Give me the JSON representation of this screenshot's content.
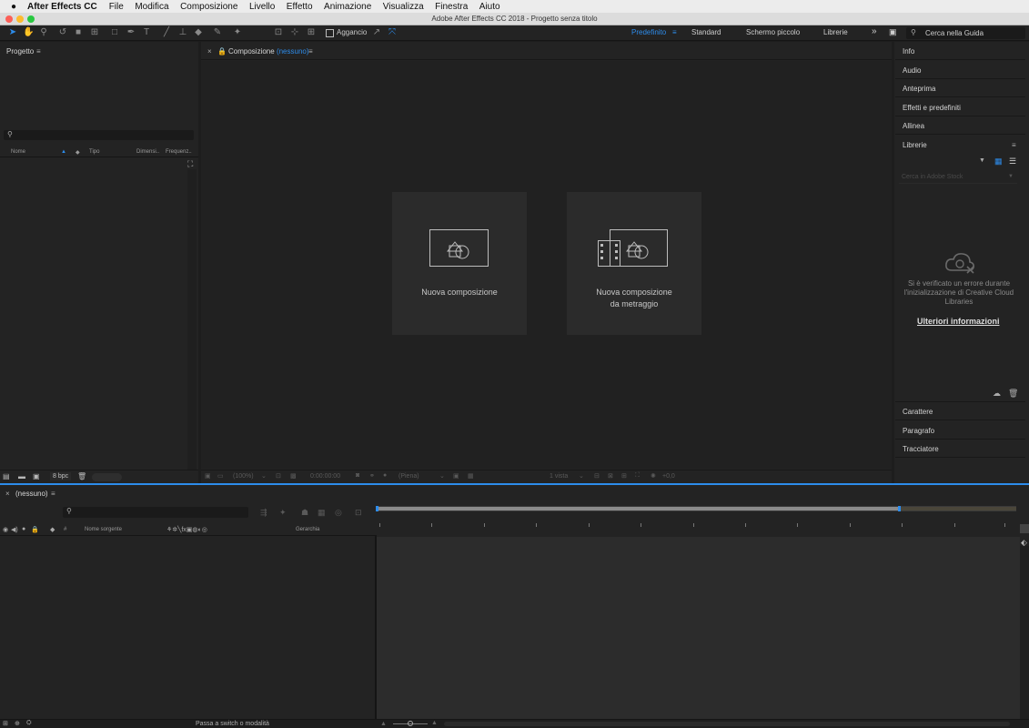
{
  "menubar": {
    "app_name": "After Effects CC",
    "items": [
      "File",
      "Modifica",
      "Composizione",
      "Livello",
      "Effetto",
      "Animazione",
      "Visualizza",
      "Finestra",
      "Aiuto"
    ]
  },
  "window": {
    "title": "Adobe After Effects CC 2018 - Progetto senza titolo"
  },
  "toolbar": {
    "snap_label": "Aggancio",
    "workspaces": [
      "Predefinito",
      "Standard",
      "Schermo piccolo",
      "Librerie"
    ],
    "active_workspace": "Predefinito",
    "search_placeholder": "Cerca nella Guida"
  },
  "project_panel": {
    "title": "Progetto",
    "columns": [
      "Nome",
      "Tipo",
      "Dimensi..",
      "Frequenz.."
    ],
    "bpc": "8 bpc"
  },
  "composition_panel": {
    "tab_prefix": "Composizione",
    "tab_name": "(nessuno)",
    "tile_new_comp": "Nuova composizione",
    "tile_from_footage_line1": "Nuova composizione",
    "tile_from_footage_line2": "da metraggio",
    "zoom": "(100%)",
    "timecode": "0:00:00:00",
    "resolution": "(Piena)",
    "views": "1 vista",
    "exposure": "+0,0"
  },
  "right_panels": {
    "top": [
      "Info",
      "Audio",
      "Anteprima",
      "Effetti e predefiniti",
      "Allinea"
    ],
    "libraries_title": "Librerie",
    "stock_placeholder": "Cerca in Adobe Stock",
    "error_text": "Si è verificato un errore durante l'inizializzazione di Creative Cloud Libraries",
    "more_info_link": "Ulteriori informazioni",
    "bottom": [
      "Carattere",
      "Paragrafo",
      "Tracciatore"
    ]
  },
  "timeline": {
    "tab_name": "(nessuno)",
    "col_source_name": "Nome sorgente",
    "col_hash": "#",
    "col_parent": "Gerarchia",
    "switch_modes": "Passa a switch o modalità"
  },
  "colors": {
    "accent": "#2d8ceb",
    "panel": "#232323",
    "bg": "#1d1d1d"
  }
}
